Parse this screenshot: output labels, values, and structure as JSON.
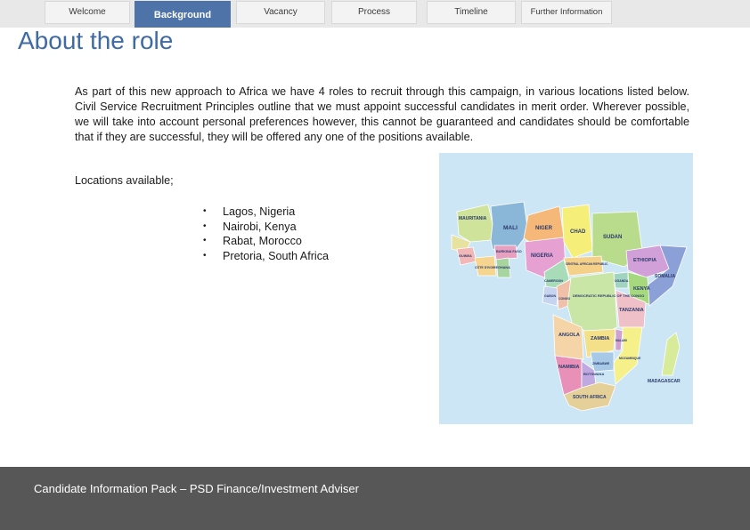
{
  "nav": {
    "tabs": [
      {
        "label": "Welcome"
      },
      {
        "label": "Background"
      },
      {
        "label": "Vacancy"
      },
      {
        "label": "Process"
      },
      {
        "label": "Timeline"
      },
      {
        "label": "Further Information"
      }
    ],
    "active_tab": "Background",
    "active_color": "#4d73a8"
  },
  "page": {
    "title": "About the role",
    "intro": "As part of this new approach to Africa we have 4 roles to recruit through this campaign, in various locations listed below.  Civil Service Recruitment Principles outline that we must appoint successful candidates in merit order.  Wherever possible, we will take into account personal preferences however, this cannot be guaranteed and candidates should be comfortable that if they are successful, they will be offered any one of the positions available.",
    "locations_label": "Locations available;",
    "locations": [
      "Lagos, Nigeria",
      "Nairobi, Kenya",
      "Rabat, Morocco",
      "Pretoria, South Africa"
    ],
    "bullet": "•"
  },
  "map": {
    "labels": {
      "mauritania": "MAURITANIA",
      "mali": "MALI",
      "niger": "NIGER",
      "chad": "CHAD",
      "sudan": "SUDAN",
      "ethiopia": "ETHIOPIA",
      "somalia": "SOMALIA",
      "kenya": "KENYA",
      "nigeria": "NIGERIA",
      "drc": "DEMOCRATIC REPUBLIC OF THE CONGO",
      "tanzania": "TANZANIA",
      "angola": "ANGOLA",
      "zambia": "ZAMBIA",
      "namibia": "NAMIBIA",
      "botswana": "BOTSWANA",
      "south_africa": "SOUTH AFRICA",
      "madagascar": "MADAGASCAR",
      "burkina_faso": "BURKINA FASO",
      "guinea": "GUINEA",
      "cote_divoire": "CÔTE D'IVOIRE",
      "ghana": "GHANA",
      "central_african_republic": "CENTRAL AFRICAN REPUBLIC",
      "cameroon": "CAMEROON",
      "gabon": "GABON",
      "congo": "CONGO",
      "uganda": "UGANDA",
      "mozambique": "MOZAMBIQUE",
      "zimbabwe": "ZIMBABWE",
      "malawi": "MALAWI"
    }
  },
  "footer": {
    "text": "Candidate Information Pack – PSD Finance/Investment Adviser",
    "background": "#575757"
  }
}
